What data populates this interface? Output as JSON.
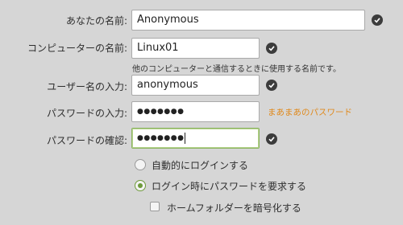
{
  "form": {
    "name_label": "あなたの名前:",
    "name_value": "Anonymous",
    "computer_label": "コンピューターの名前:",
    "computer_value": "Linux01",
    "computer_hint": "他のコンピューターと通信するときに使用する名前です。",
    "username_label": "ユーザー名の入力:",
    "username_value": "anonymous",
    "password_label": "パスワードの入力:",
    "password_value": "●●●●●●●",
    "password_strength": "まあまあのパスワード",
    "confirm_label": "パスワードの確認:",
    "confirm_value": "●●●●●●●"
  },
  "options": {
    "auto_login_label": "自動的にログインする",
    "require_password_label": "ログイン時にパスワードを要求する",
    "encrypt_home_label": "ホームフォルダーを暗号化する",
    "selected": "require_password",
    "encrypt_home_checked": false
  },
  "colors": {
    "background": "#d6d6d6",
    "accent": "#6d9a3a",
    "strength": "#e08a1e"
  }
}
